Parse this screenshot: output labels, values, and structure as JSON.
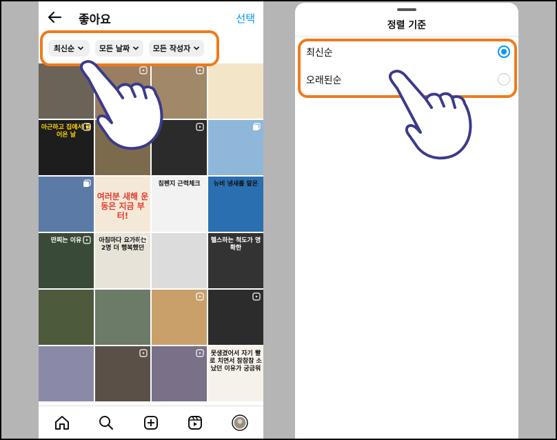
{
  "left_screen": {
    "header": {
      "title": "좋아요",
      "select_label": "선택"
    },
    "filters": [
      {
        "label": "최신순"
      },
      {
        "label": "모든 날짜"
      },
      {
        "label": "모든 작성자"
      }
    ],
    "tiles": [
      {
        "bg": "#6b6258",
        "cap": "",
        "icon": ""
      },
      {
        "bg": "#9a7e62",
        "cap": "",
        "icon": "reel"
      },
      {
        "bg": "#a08868",
        "cap": "",
        "icon": "reel"
      },
      {
        "bg": "#f3e6c8",
        "cap": "",
        "icon": ""
      },
      {
        "bg": "#1d1d1d",
        "cap": "아근하고 집에서 들어온 날",
        "icon": "reel",
        "capColor": "#ffd400"
      },
      {
        "bg": "#7c6a4c",
        "cap": "",
        "icon": ""
      },
      {
        "bg": "#2b2b2b",
        "cap": "",
        "icon": "reel"
      },
      {
        "bg": "#8fb7d9",
        "cap": "",
        "icon": "multi"
      },
      {
        "bg": "#5c7aa6",
        "cap": "",
        "icon": "multi"
      },
      {
        "bg": "#f4e9d8",
        "cap": "여러분 새해 운동은 지금 부터!",
        "icon": "",
        "capColor": "#e23b2e"
      },
      {
        "bg": "#f2f2f2",
        "cap": "침펜지 근력체크",
        "icon": "",
        "capColor": "#111"
      },
      {
        "bg": "#2a6fb0",
        "cap": "뉴비 냄새를 맡은",
        "icon": "",
        "capColor": "#111"
      },
      {
        "bg": "#3a4a38",
        "cap": "만찌는 이유",
        "icon": "reel",
        "capColor": "#fff"
      },
      {
        "bg": "#e8e3d8",
        "cap": "아침마다 요가하는 2명 더 행복했던",
        "icon": "reel",
        "capColor": "#111"
      },
      {
        "bg": "#dcdcdc",
        "cap": "",
        "icon": ""
      },
      {
        "bg": "#333",
        "cap": "헬스하는 척도가 명확한",
        "icon": "",
        "capColor": "#fff"
      },
      {
        "bg": "#4d5a3c",
        "cap": "",
        "icon": ""
      },
      {
        "bg": "#6c7a68",
        "cap": "",
        "icon": ""
      },
      {
        "bg": "#c9a06a",
        "cap": "",
        "icon": "reel"
      },
      {
        "bg": "#2c2c2c",
        "cap": "",
        "icon": "reel"
      },
      {
        "bg": "#8a8aa8",
        "cap": "",
        "icon": ""
      },
      {
        "bg": "#5a5048",
        "cap": "",
        "icon": "reel"
      },
      {
        "bg": "#7a7088",
        "cap": "",
        "icon": "reel"
      },
      {
        "bg": "#f6f2ea",
        "cap": "못생겼어서 자기 빨로 치면서 참참참 소 났던 이유가 궁금워",
        "icon": "",
        "capColor": "#111"
      }
    ],
    "nav": [
      "home-icon",
      "search-icon",
      "create-icon",
      "reels-icon",
      "profile-avatar"
    ]
  },
  "right_screen": {
    "sheet_title": "정렬 기준",
    "options": [
      {
        "label": "최신순",
        "selected": true
      },
      {
        "label": "오래된순",
        "selected": false
      }
    ]
  },
  "colors": {
    "accent": "#0095f6",
    "highlight": "#f07a1a"
  }
}
